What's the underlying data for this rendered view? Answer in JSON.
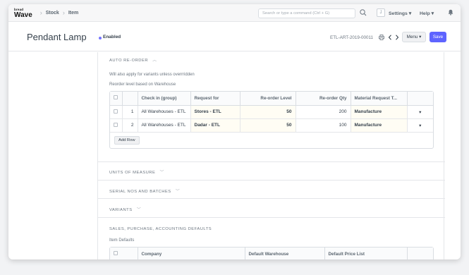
{
  "navbar": {
    "logo_small": "bread",
    "logo_main": "Wave",
    "breadcrumbs": [
      "Stock",
      "Item"
    ],
    "search_placeholder": "Search or type a command (Ctrl + G)",
    "avatar_letter": "J",
    "settings_label": "Settings",
    "help_label": "Help"
  },
  "page": {
    "title": "Pendant Lamp",
    "status": "Enabled",
    "doc_id": "ETL-ART-2019-00011",
    "menu_label": "Menu",
    "save_label": "Save"
  },
  "auto_reorder": {
    "heading": "AUTO RE-ORDER",
    "note1": "Will also apply for variants unless overrridden",
    "note2": "Reorder level based on Warehouse",
    "columns": [
      "Check in (group)",
      "Request for",
      "Re-order Level",
      "Re-order Qty",
      "Material Request T..."
    ],
    "rows": [
      {
        "idx": "1",
        "check_in": "All Warehouses - ETL",
        "request_for": "Stores - ETL",
        "level": "50",
        "qty": "200",
        "type": "Manufacture"
      },
      {
        "idx": "2",
        "check_in": "All Warehouses - ETL",
        "request_for": "Dadar - ETL",
        "level": "50",
        "qty": "100",
        "type": "Manufacture"
      }
    ],
    "add_row_label": "Add Row"
  },
  "sections": {
    "units": "UNITS OF MEASURE",
    "serial": "SERIAL NOS AND BATCHES",
    "variants": "VARIANTS",
    "sales": "SALES, PURCHASE, ACCOUNTING DEFAULTS"
  },
  "item_defaults": {
    "label": "Item Defaults",
    "columns": [
      "Company",
      "Default Warehouse",
      "Default Price List"
    ]
  },
  "colors": {
    "accent": "#5e64ff",
    "status_dot": "#7575ff"
  }
}
